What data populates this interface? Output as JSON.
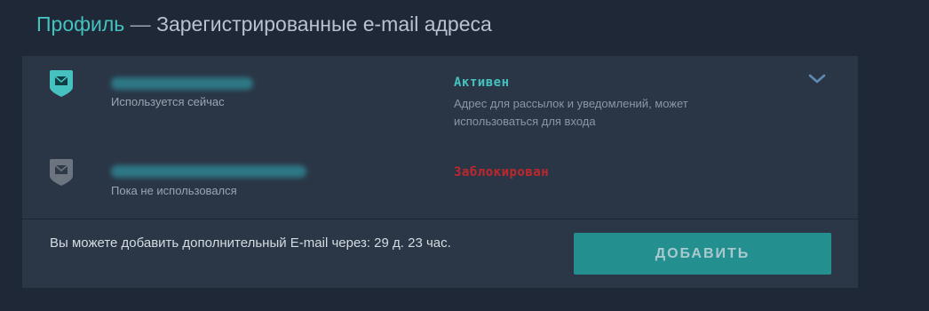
{
  "header": {
    "link_label": "Профиль",
    "separator": " — ",
    "title": "Зарегистрированные e-mail адреса"
  },
  "emails": [
    {
      "icon": "mail-shield-icon",
      "shield_color": "#45c2c0",
      "usage": "Используется сейчас",
      "status": "Активен",
      "status_color": "#45c2c0",
      "status_description": "Адрес для рассылок и уведомлений, может использоваться для входа"
    },
    {
      "icon": "mail-shield-icon",
      "shield_color": "#6b747f",
      "usage": "Пока не использовался",
      "status": "Заблокирован",
      "status_color": "#c0272d"
    }
  ],
  "expand_icon": "chevron-down-icon",
  "footer": {
    "note": "Вы можете добавить дополнительный E-mail через: 29 д. 23 час.",
    "add_button_label": "ДОБАВИТЬ"
  },
  "colors": {
    "accent": "#45c2c0",
    "button": "#23908f",
    "background": "#1e2837",
    "card": "#2b3746",
    "blocked": "#c0272d"
  }
}
